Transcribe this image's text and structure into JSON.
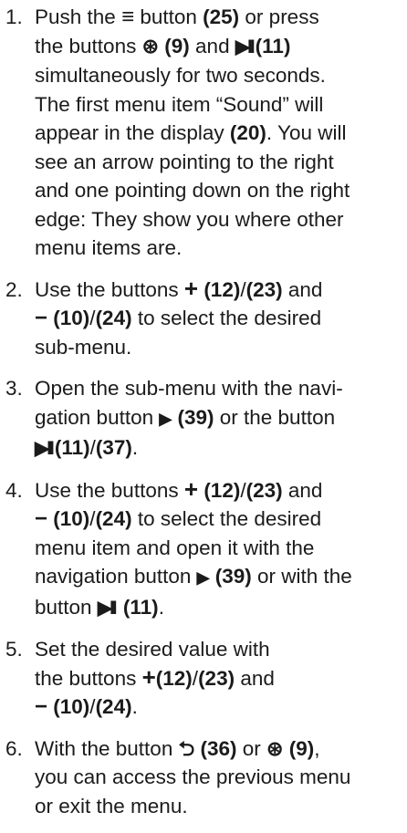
{
  "steps": [
    {
      "num": "1.",
      "lines": {
        "l1a": "Push the ",
        "l1b": " button ",
        "l1c": " or press",
        "l2a": "the buttons ",
        "l2b": " and ",
        "l3": "simultaneously for two seconds.",
        "l4": "The first menu item “Sound” will",
        "l5a": "appear in the display ",
        "l5b": ". You will",
        "l6": "see an arrow pointing to the right",
        "l7": "and one pointing down on the right",
        "l8": "edge: They show you where other",
        "l9": "menu items are."
      },
      "refs": {
        "r25": "(25)",
        "r9": "(9)",
        "r11": "(11)",
        "r20": "(20)"
      }
    },
    {
      "num": "2.",
      "lines": {
        "l1a": "Use the buttons ",
        "l1b": "/",
        "l1c": " and",
        "l2b": "/",
        "l2c": " to select the desired",
        "l3": "sub-menu."
      },
      "refs": {
        "r12": "(12)",
        "r23": "(23)",
        "r10": "(10)",
        "r24": "(24)"
      }
    },
    {
      "num": "3.",
      "lines": {
        "l1": "Open the sub-menu with the navi-",
        "l2a": "gation button ",
        "l2b": " or the button",
        "l3b": "/",
        "l3c": "."
      },
      "refs": {
        "r39": "(39)",
        "r11": "(11)",
        "r37": "(37)"
      }
    },
    {
      "num": "4.",
      "lines": {
        "l1a": "Use the buttons ",
        "l1b": "/",
        "l1c": " and",
        "l2b": "/",
        "l2c": " to select the desired",
        "l3": "menu item and open it with the",
        "l4a": "navigation button ",
        "l4b": " or with the",
        "l5a": "button ",
        "l5b": "."
      },
      "refs": {
        "r12": "(12)",
        "r23": "(23)",
        "r10": "(10)",
        "r24": "(24)",
        "r39": "(39)",
        "r11": "(11)"
      }
    },
    {
      "num": "5.",
      "lines": {
        "l1": "Set the desired value with",
        "l2a": "the buttons ",
        "l2b": "/",
        "l2c": " and",
        "l3b": "/",
        "l3c": "."
      },
      "refs": {
        "r12": "(12)",
        "r23": "(23)",
        "r10": "(10)",
        "r24": "(24)"
      }
    },
    {
      "num": "6.",
      "lines": {
        "l1a": "With the button ",
        "l1b": " or ",
        "l1c": ",",
        "l2": "you can access the previous menu",
        "l3": "or exit the menu."
      },
      "refs": {
        "r36": "(36)",
        "r9": "(9)"
      }
    }
  ],
  "icons": {
    "menu": "≡",
    "source": "⊛",
    "play_pause": "▶II",
    "plus": "+",
    "minus": "−",
    "right": "▶",
    "back": "⮌"
  }
}
